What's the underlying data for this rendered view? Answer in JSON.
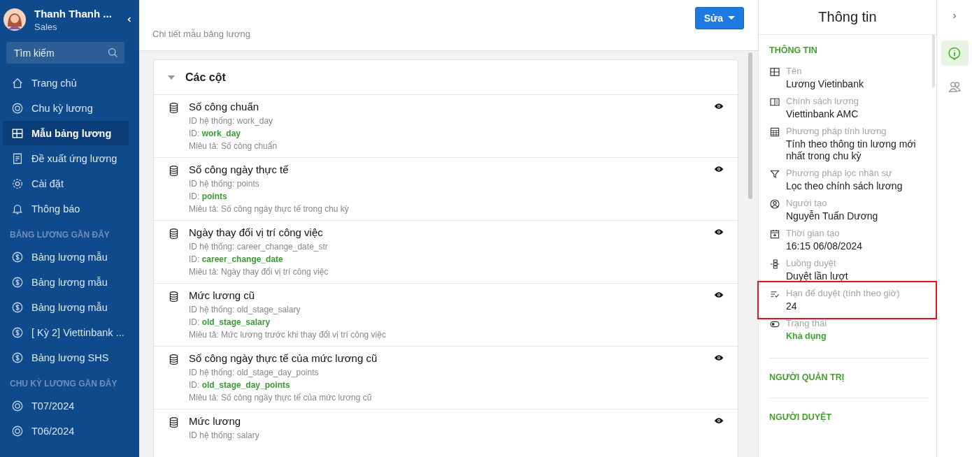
{
  "user": {
    "name": "Thanh Thanh ...",
    "role": "Sales"
  },
  "sidebar": {
    "search": {
      "placeholder": "Tìm kiếm"
    },
    "nav": [
      {
        "kind": "home",
        "label": "Trang chủ",
        "selected": false
      },
      {
        "kind": "cycle",
        "label": "Chu kỳ lương",
        "selected": false
      },
      {
        "kind": "layout",
        "label": "Mẫu bảng lương",
        "selected": true
      },
      {
        "kind": "doc",
        "label": "Đề xuất ứng lương",
        "selected": false
      },
      {
        "kind": "gear",
        "label": "Cài đặt",
        "selected": false
      },
      {
        "kind": "bell",
        "label": "Thông báo",
        "selected": false
      }
    ],
    "sections": [
      {
        "kind": "dollar",
        "title": "BẢNG LƯƠNG GẦN ĐÂY",
        "items": [
          "Bảng lương mẫu",
          "Bảng lương mẫu",
          "Bảng lương mẫu",
          "[ Kỳ 2] Viettinbank ...",
          "Bảng lương SHS"
        ]
      },
      {
        "kind": "cycle",
        "title": "CHU KỲ LƯƠNG GẦN ĐÂY",
        "items": [
          "T07/2024",
          "T06/2024"
        ]
      }
    ]
  },
  "header": {
    "subtitle": "Chi tiết mẫu bảng lương",
    "edit_button": "Sửa"
  },
  "columns_card": {
    "title": "Các cột",
    "expanded": true,
    "rows": [
      {
        "name": "Số công chuẩn",
        "system_id": "ID hệ thống: work_day",
        "id_label": "ID:",
        "id": "work_day",
        "description": "Miêu tả: Số công chuẩn"
      },
      {
        "name": "Số công ngày thực tế",
        "system_id": "ID hệ thống: points",
        "id_label": "ID:",
        "id": "points",
        "description": "Miêu tả: Số công ngày thực tế trong chu kỳ"
      },
      {
        "name": "Ngày thay đổi vị trí công việc",
        "system_id": "ID hệ thống: career_change_date_str",
        "id_label": "ID:",
        "id": "career_change_date",
        "description": "Miêu tả: Ngày thay đổi vị trí công việc"
      },
      {
        "name": "Mức lương cũ",
        "system_id": "ID hệ thống: old_stage_salary",
        "id_label": "ID:",
        "id": "old_stage_salary",
        "description": "Miêu tả: Mức lương trước khi thay đổi vị trí công việc"
      },
      {
        "name": "Số công ngày thực tế của mức lương cũ",
        "system_id": "ID hệ thống: old_stage_day_points",
        "id_label": "ID:",
        "id": "old_stage_day_points",
        "description": "Miêu tả: Số công ngày thực tế của mức lương cũ"
      },
      {
        "name": "Mức lương",
        "system_id": "ID hệ thống: salary"
      }
    ]
  },
  "info_panel": {
    "title": "Thông tin",
    "section": "THÔNG TIN",
    "fields": [
      {
        "kind": "layout",
        "label": "Tên",
        "value": "Lương Vietinbank",
        "highlighted": false
      },
      {
        "kind": "book",
        "label": "Chính sách lương",
        "value": "Viettinbank AMC",
        "highlighted": false
      },
      {
        "kind": "calc",
        "label": "Phương pháp tính lương",
        "value": "Tính theo thông tin lương mới nhất trong chu kỳ",
        "highlighted": false
      },
      {
        "kind": "filter",
        "label": "Phương pháp lọc nhân sự",
        "value": "Lọc theo chính sách lương",
        "highlighted": false
      },
      {
        "kind": "user",
        "label": "Người tạo",
        "value": "Nguyễn Tuấn Dương",
        "highlighted": false
      },
      {
        "kind": "calendar",
        "label": "Thời gian tạo",
        "value": "16:15 06/08/2024",
        "highlighted": false
      },
      {
        "kind": "flow",
        "label": "Luồng duyệt",
        "value": "Duyệt lần lượt",
        "highlighted": false
      },
      {
        "kind": "listcheck",
        "label": "Hạn để duyệt (tính theo giờ)",
        "value": "24",
        "highlighted": true
      },
      {
        "kind": "status",
        "label": "Trạng thái",
        "value": "Khả dụng",
        "highlighted": false
      }
    ],
    "sections": [
      "NGƯỜI QUẢN TRỊ",
      "NGƯỜI DUYỆT"
    ]
  },
  "rail": [
    {
      "kind": "info",
      "selected": true
    },
    {
      "kind": "users",
      "selected": false
    }
  ]
}
